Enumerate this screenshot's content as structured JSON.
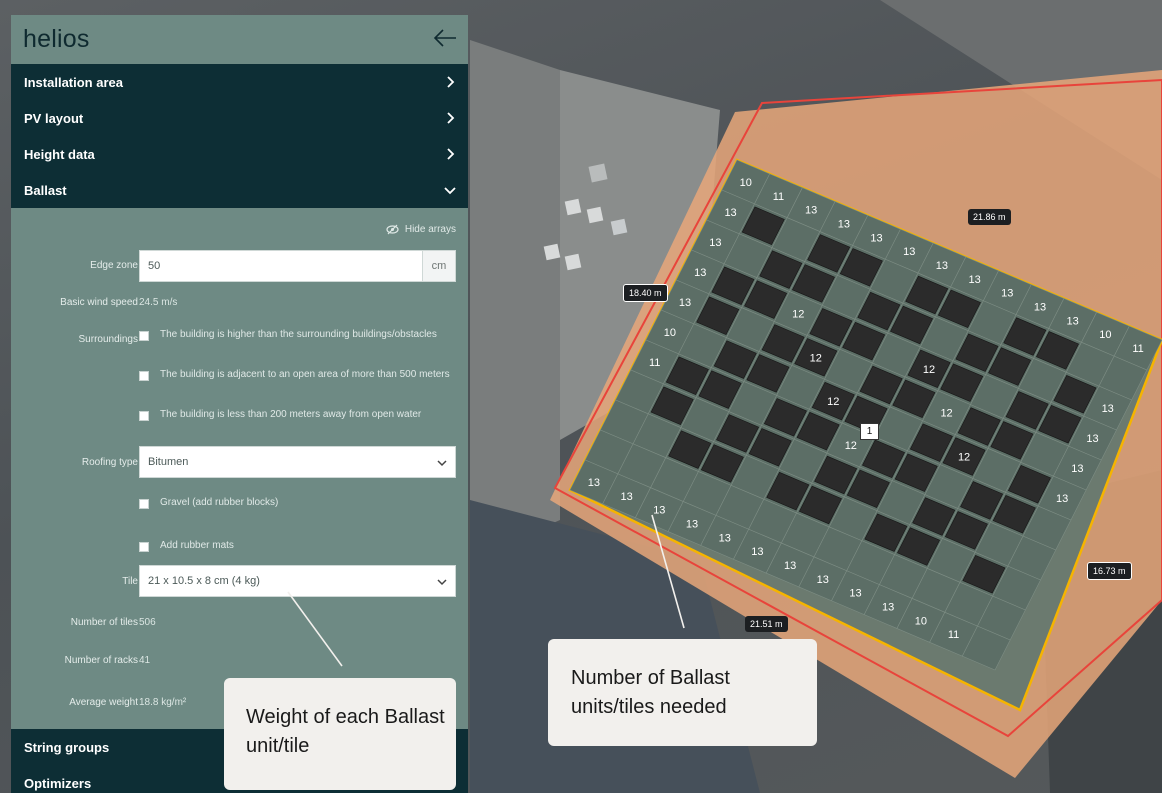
{
  "app": {
    "brand": "helios"
  },
  "panel": {
    "sections": [
      {
        "label": "Installation area",
        "expanded": false
      },
      {
        "label": "PV layout",
        "expanded": false
      },
      {
        "label": "Height data",
        "expanded": false
      },
      {
        "label": "Ballast",
        "expanded": true
      }
    ],
    "footer_sections": [
      {
        "label": "String groups"
      },
      {
        "label": "Optimizers"
      }
    ]
  },
  "ballast": {
    "hide_arrays_label": "Hide arrays",
    "edge_zone": {
      "label": "Edge zone",
      "value": "50",
      "unit": "cm"
    },
    "basic_wind_speed": {
      "label": "Basic wind speed",
      "value": "24.5 m/s"
    },
    "surroundings": {
      "label": "Surroundings",
      "options": [
        {
          "text": "The building is higher than the surrounding buildings/obstacles",
          "checked": false
        },
        {
          "text": "The building is adjacent to an open area of more than 500 meters",
          "checked": false
        },
        {
          "text": "The building is less than 200 meters away from open water",
          "checked": false
        }
      ]
    },
    "roofing_type": {
      "label": "Roofing type",
      "value": "Bitumen"
    },
    "gravel_option": {
      "text": "Gravel (add rubber blocks)",
      "checked": false
    },
    "rubber_mats_option": {
      "text": "Add rubber mats",
      "checked": false
    },
    "tile": {
      "label": "Tile",
      "value": "21 x 10.5 x 8 cm (4 kg)"
    },
    "number_of_tiles": {
      "label": "Number of tiles",
      "value": "506"
    },
    "number_of_racks": {
      "label": "Number of racks",
      "value": "41"
    },
    "average_weight": {
      "label": "Average weight",
      "value": "18.8 kg/m²"
    }
  },
  "map": {
    "dimensions": [
      "21.86 m",
      "18.40 m",
      "16.73 m",
      "21.51 m"
    ],
    "array_label": "1",
    "ballast_counts": {
      "top_row": [
        "10",
        "11",
        "13",
        "13",
        "13",
        "13",
        "13",
        "13",
        "13",
        "13",
        "13",
        "10",
        "11"
      ],
      "left_col": [
        "13",
        "13",
        "13",
        "13",
        "10",
        "11"
      ],
      "bottom_row": [
        "13",
        "13",
        "13",
        "13",
        "13",
        "13",
        "13",
        "13",
        "13",
        "13",
        "10",
        "11"
      ],
      "right_col": [
        "13",
        "13",
        "13",
        "13"
      ],
      "inner": [
        "12",
        "12",
        "12",
        "12",
        "12",
        "12",
        "12"
      ]
    },
    "colors": {
      "edge_zone": "#f2a46b",
      "roof_outline": "#e8443b",
      "array_outline": "#f5b400",
      "panel": "#2b2b2b",
      "ballast_cell": "#5c6e66"
    }
  },
  "callouts": {
    "weight": "Weight of each Ballast unit/tile",
    "number": "Number of Ballast units/tiles needed"
  }
}
